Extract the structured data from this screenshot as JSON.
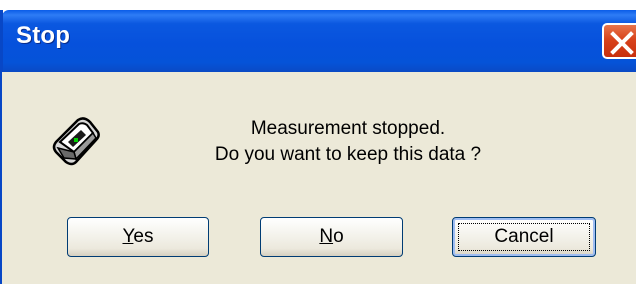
{
  "dialog": {
    "title": "Stop",
    "close_icon": "close-icon",
    "message_icon": "measurement-device-icon",
    "message_line1": "Measurement stopped.",
    "message_line2": "Do you want to keep this data ?"
  },
  "buttons": {
    "yes": {
      "mnemonic": "Y",
      "rest": "es"
    },
    "no": {
      "mnemonic": "N",
      "rest": "o"
    },
    "cancel": {
      "label": "Cancel"
    }
  },
  "colors": {
    "titlebar_blue": "#0651dc",
    "close_red": "#d8431c",
    "client_bg": "#ece9d8"
  }
}
